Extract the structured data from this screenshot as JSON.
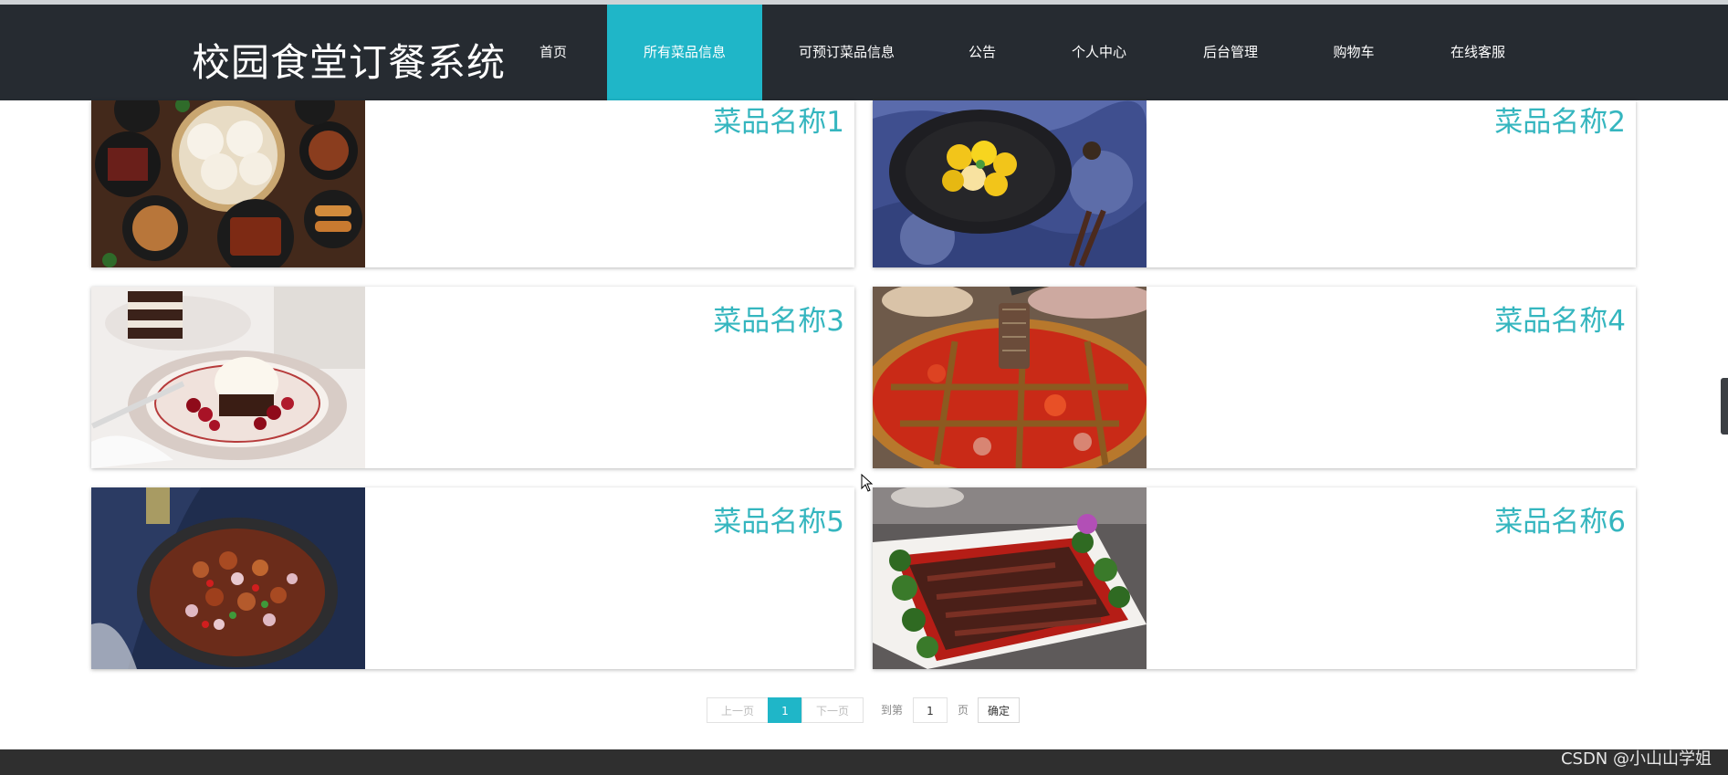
{
  "brand": {
    "title": "校园食堂订餐系统"
  },
  "nav": {
    "items": [
      {
        "label": "首页"
      },
      {
        "label": "所有菜品信息"
      },
      {
        "label": "可预订菜品信息"
      },
      {
        "label": "公告"
      },
      {
        "label": "个人中心"
      },
      {
        "label": "后台管理"
      },
      {
        "label": "购物车"
      },
      {
        "label": "在线客服"
      }
    ],
    "active_label": "所有菜品信息"
  },
  "dishes": [
    {
      "name": "菜品名称1",
      "image": "dim-sum-spread-image"
    },
    {
      "name": "菜品名称2",
      "image": "mango-dessert-image"
    },
    {
      "name": "菜品名称3",
      "image": "brownie-ice-cream-image"
    },
    {
      "name": "菜品名称4",
      "image": "hotpot-image"
    },
    {
      "name": "菜品名称5",
      "image": "braised-chicken-image"
    },
    {
      "name": "菜品名称6",
      "image": "braised-meat-broccoli-image"
    }
  ],
  "pagination": {
    "prev_label": "上一页",
    "current_page": "1",
    "next_label": "下一页",
    "goto_prefix": "到第",
    "goto_value": "1",
    "goto_suffix": "页",
    "confirm_label": "确定"
  },
  "watermark": "CSDN @小山山学姐",
  "colors": {
    "nav_bg": "#262b31",
    "accent": "#1fb6c8",
    "dish_name": "#35b6bf"
  }
}
